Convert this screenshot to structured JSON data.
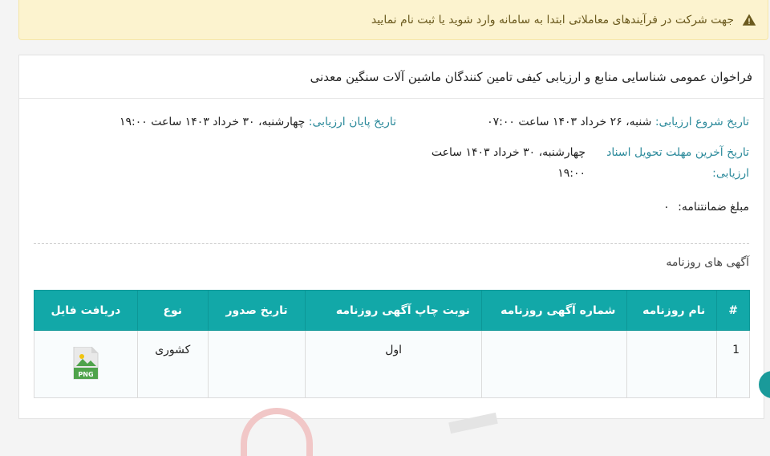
{
  "alert": {
    "text": "جهت شرکت در فرآیندهای معاملاتی ابتدا به سامانه وارد شوید یا ثبت نام نمایید",
    "icon": "warning-icon"
  },
  "tender": {
    "title": "فراخوان عمومی شناسایی منابع و ارزیابی کیفی تامین کنندگان ماشین آلات سنگین معدنی",
    "start_label": "تاریخ شروع ارزیابی:",
    "start_value": "شنبه، ۲۶ خرداد ۱۴۰۳ ساعت ۰۷:۰۰",
    "end_label": "تاریخ پایان ارزیابی:",
    "end_value": "چهارشنبه، ۳۰ خرداد ۱۴۰۳ ساعت ۱۹:۰۰",
    "deadline_label_1": "تاریخ آخرین مهلت تحویل اسناد",
    "deadline_label_2": "ارزیابی:",
    "deadline_value_1": "چهارشنبه، ۳۰ خرداد ۱۴۰۳ ساعت",
    "deadline_value_2": "۱۹:۰۰",
    "guarantee_label": "مبلغ ضمانتنامه:",
    "guarantee_value": "۰"
  },
  "ads": {
    "section_title": "آگهی های روزنامه",
    "columns": [
      "#",
      "نام روزنامه",
      "شماره آگهی روزنامه",
      "نوبت چاپ آگهی روزنامه",
      "تاریخ صدور",
      "نوع",
      "دریافت فایل"
    ],
    "rows": [
      {
        "index": "1",
        "newspaper": "",
        "ad_number": "",
        "print_round": "اول",
        "issue_date": "",
        "type": "کشوری",
        "file_badge": "PNG"
      }
    ]
  },
  "colors": {
    "accent": "#12a8a8",
    "label": "#2c8a9b",
    "alert_bg": "#fcf3cf",
    "png_green": "#4fa34b"
  }
}
